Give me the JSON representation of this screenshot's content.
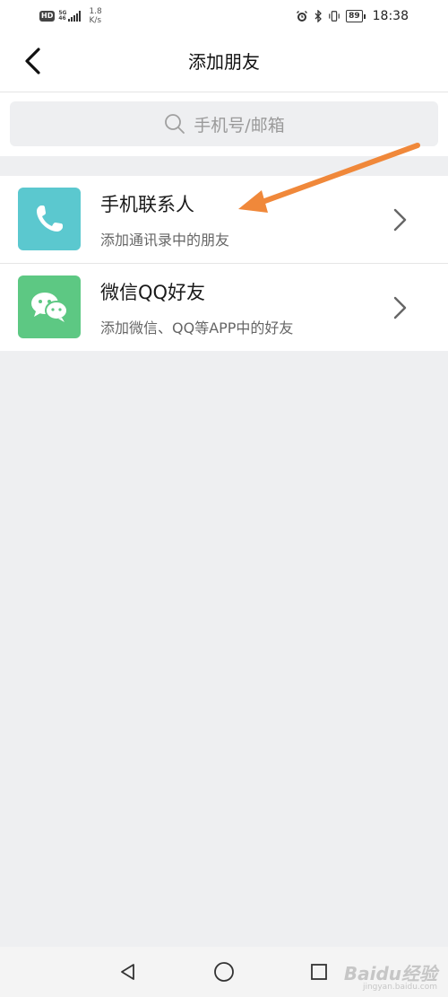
{
  "status_bar": {
    "hd_badge": "HD",
    "network_top": "5G",
    "network_bottom": "46",
    "speed_value": "1.8",
    "speed_unit": "K/s",
    "battery": "89",
    "time": "18:38",
    "icons": [
      "alarm-icon",
      "bluetooth-icon",
      "vibrate-icon",
      "battery-icon"
    ]
  },
  "header": {
    "title": "添加朋友",
    "back_icon": "chevron-left-icon"
  },
  "search": {
    "placeholder": "手机号/邮箱",
    "icon": "search-icon"
  },
  "list": {
    "items": [
      {
        "title": "手机联系人",
        "subtitle": "添加通讯录中的朋友",
        "icon": "phone-icon",
        "icon_color": "#5bc8cf"
      },
      {
        "title": "微信QQ好友",
        "subtitle": "添加微信、QQ等APP中的好友",
        "icon": "wechat-icon",
        "icon_color": "#5dc883"
      }
    ]
  },
  "annotation": {
    "arrow_color": "#f0883a"
  },
  "nav_bar": {
    "buttons": [
      "back-triangle-icon",
      "home-circle-icon",
      "recents-square-icon"
    ]
  },
  "watermark": {
    "brand": "Baidu经验",
    "url": "jingyan.baidu.com"
  }
}
